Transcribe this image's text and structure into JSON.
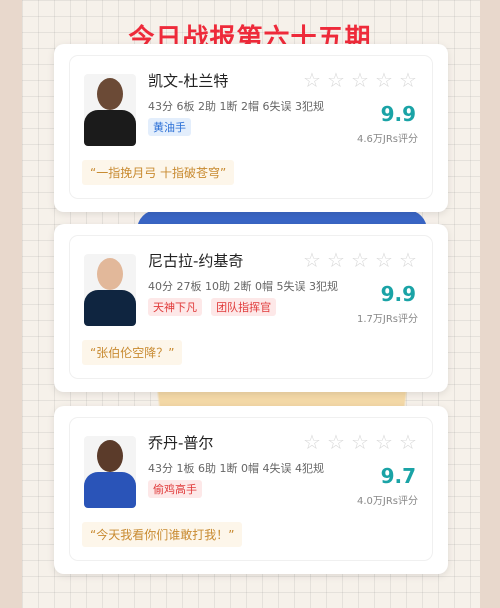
{
  "header": {
    "title": "今日战报第六十五期"
  },
  "players": [
    {
      "name": "凯文-杜兰特",
      "stats": "43分 6板 2助 1断 2帽 6失误 3犯规",
      "tags": [
        "黄油手"
      ],
      "tag_colors": [
        "blue"
      ],
      "score": "9.9",
      "votes": "4.6万JRs评分",
      "quote": "“一指挽月弓 十指破苍穹”",
      "avatar_colors": {
        "skin": "#6b4a36",
        "jersey": "#1b1b1b"
      }
    },
    {
      "name": "尼古拉-约基奇",
      "stats": "40分 27板 10助 2断 0帽 5失误 3犯规",
      "tags": [
        "天神下凡",
        "团队指挥官"
      ],
      "tag_colors": [
        "red",
        "red"
      ],
      "score": "9.9",
      "votes": "1.7万JRs评分",
      "quote": "“张伯伦空降？”",
      "avatar_colors": {
        "skin": "#e2b89a",
        "jersey": "#0f2540"
      }
    },
    {
      "name": "乔丹-普尔",
      "stats": "43分 1板 6助 1断 0帽 4失误 4犯规",
      "tags": [
        "偷鸡高手"
      ],
      "tag_colors": [
        "red"
      ],
      "score": "9.7",
      "votes": "4.0万JRs评分",
      "quote": "“今天我看你们谁敢打我！”",
      "avatar_colors": {
        "skin": "#5b3b2a",
        "jersey": "#2a54b8"
      }
    }
  ],
  "icons": {
    "star": "star-outline-icon"
  },
  "colors": {
    "title": "#ee2a3a",
    "score": "#1aa3a6",
    "quote": "#c88a30"
  }
}
